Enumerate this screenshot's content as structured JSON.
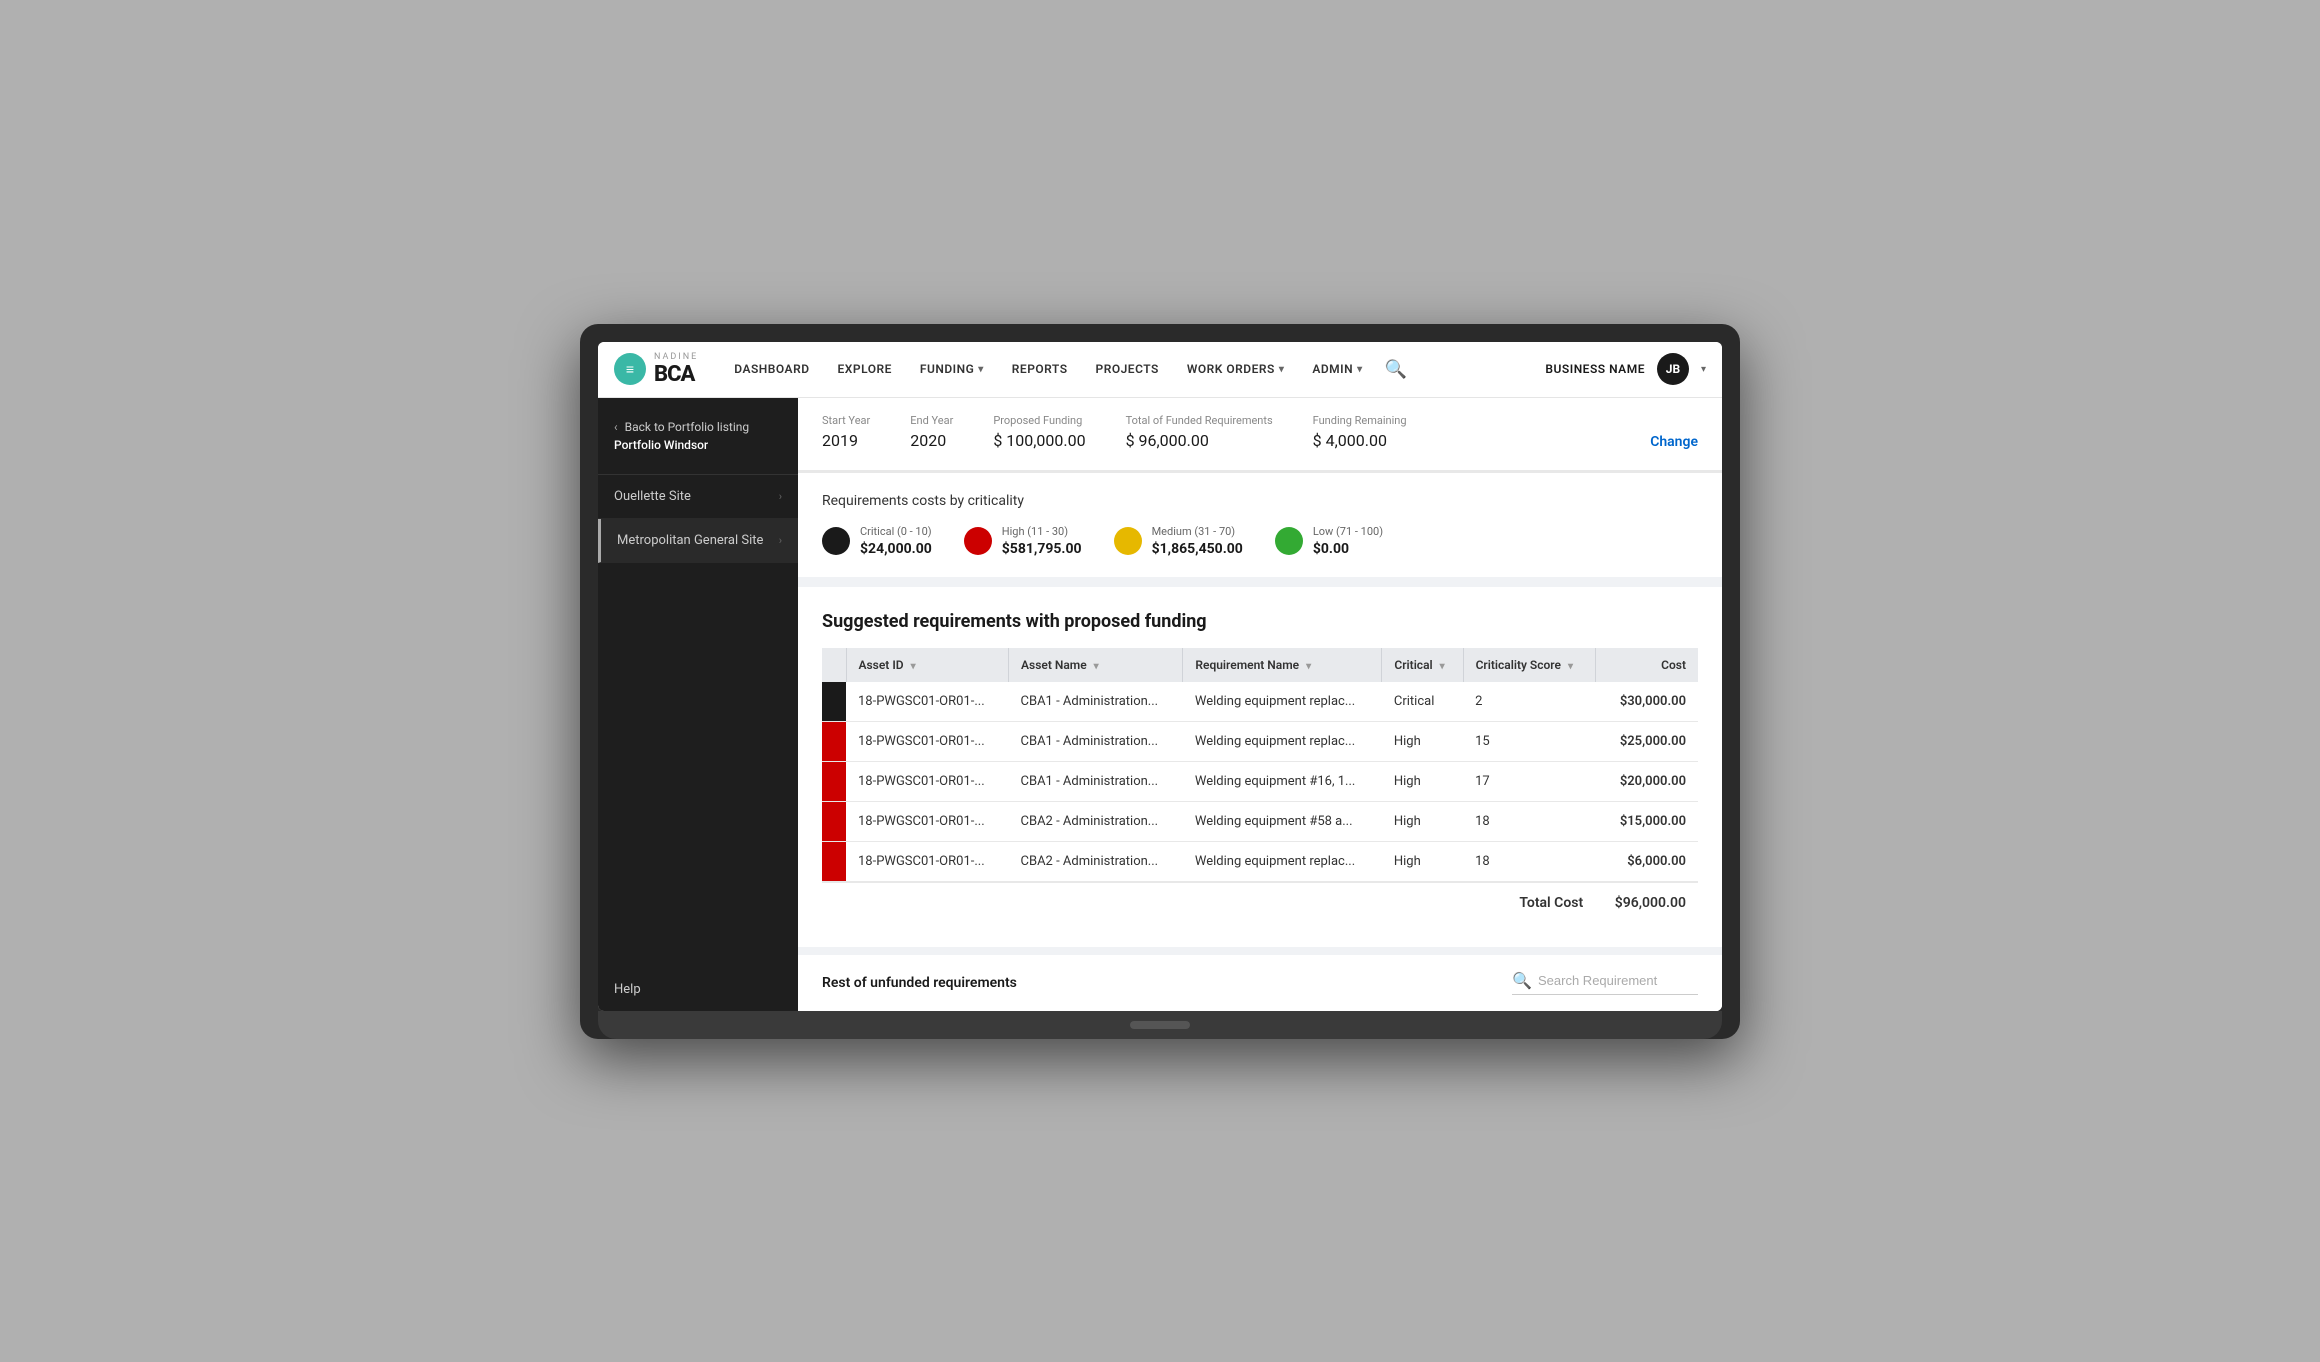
{
  "nav": {
    "logo_text": "BCA",
    "logo_nadine": "NADINE",
    "logo_initials": "≡",
    "items": [
      {
        "label": "DASHBOARD",
        "has_dropdown": false
      },
      {
        "label": "EXPLORE",
        "has_dropdown": false
      },
      {
        "label": "FUNDING",
        "has_dropdown": true
      },
      {
        "label": "REPORTS",
        "has_dropdown": false
      },
      {
        "label": "PROJECTS",
        "has_dropdown": false
      },
      {
        "label": "WORK ORDERS",
        "has_dropdown": true
      },
      {
        "label": "ADMIN",
        "has_dropdown": true
      }
    ],
    "business_name": "BUSINESS NAME",
    "avatar_initials": "JB"
  },
  "sidebar": {
    "back_link": "Back to Portfolio listing",
    "portfolio_name": "Portfolio Windsor",
    "nav_items": [
      {
        "label": "Ouellette Site"
      },
      {
        "label": "Metropolitan General Site"
      }
    ],
    "help_label": "Help"
  },
  "funding": {
    "start_year_label": "Start Year",
    "start_year": "2019",
    "end_year_label": "End Year",
    "end_year": "2020",
    "proposed_label": "Proposed Funding",
    "proposed": "$ 100,000.00",
    "total_funded_label": "Total of Funded Requirements",
    "total_funded": "$ 96,000.00",
    "remaining_label": "Funding Remaining",
    "remaining": "$ 4,000.00",
    "change_label": "Change"
  },
  "criticality": {
    "title": "Requirements costs by criticality",
    "items": [
      {
        "label": "Critical (0 - 10)",
        "amount": "$24,000.00",
        "color": "#1a1a1a"
      },
      {
        "label": "High (11 - 30)",
        "amount": "$581,795.00",
        "color": "#cc0000"
      },
      {
        "label": "Medium (31 - 70)",
        "amount": "$1,865,450.00",
        "color": "#e6b800"
      },
      {
        "label": "Low (71 - 100)",
        "amount": "$0.00",
        "color": "#33aa33"
      }
    ]
  },
  "suggested": {
    "title": "Suggested requirements with proposed funding",
    "table": {
      "columns": [
        "Asset ID",
        "Asset Name",
        "Requirement Name",
        "Critical",
        "Criticality Score",
        "Cost"
      ],
      "rows": [
        {
          "bar_class": "critical-bar",
          "asset_id": "18-PWGSC01-OR01-...",
          "asset_name": "CBA1 - Administration...",
          "req_name": "Welding equipment replac...",
          "critical": "Critical",
          "score": "2",
          "cost": "$30,000.00"
        },
        {
          "bar_class": "high-bar",
          "asset_id": "18-PWGSC01-OR01-...",
          "asset_name": "CBA1 - Administration...",
          "req_name": "Welding equipment replac...",
          "critical": "High",
          "score": "15",
          "cost": "$25,000.00"
        },
        {
          "bar_class": "high-bar",
          "asset_id": "18-PWGSC01-OR01-...",
          "asset_name": "CBA1 - Administration...",
          "req_name": "Welding equipment #16, 1...",
          "critical": "High",
          "score": "17",
          "cost": "$20,000.00"
        },
        {
          "bar_class": "high-bar",
          "asset_id": "18-PWGSC01-OR01-...",
          "asset_name": "CBA2 - Administration...",
          "req_name": "Welding equipment #58 a...",
          "critical": "High",
          "score": "18",
          "cost": "$15,000.00"
        },
        {
          "bar_class": "high-bar",
          "asset_id": "18-PWGSC01-OR01-...",
          "asset_name": "CBA2 - Administration...",
          "req_name": "Welding equipment replac...",
          "critical": "High",
          "score": "18",
          "cost": "$6,000.00"
        }
      ],
      "total_label": "Total Cost",
      "total_cost": "$96,000.00"
    }
  },
  "unfunded": {
    "title": "Rest of unfunded requirements",
    "search_placeholder": "Search Requirement"
  }
}
